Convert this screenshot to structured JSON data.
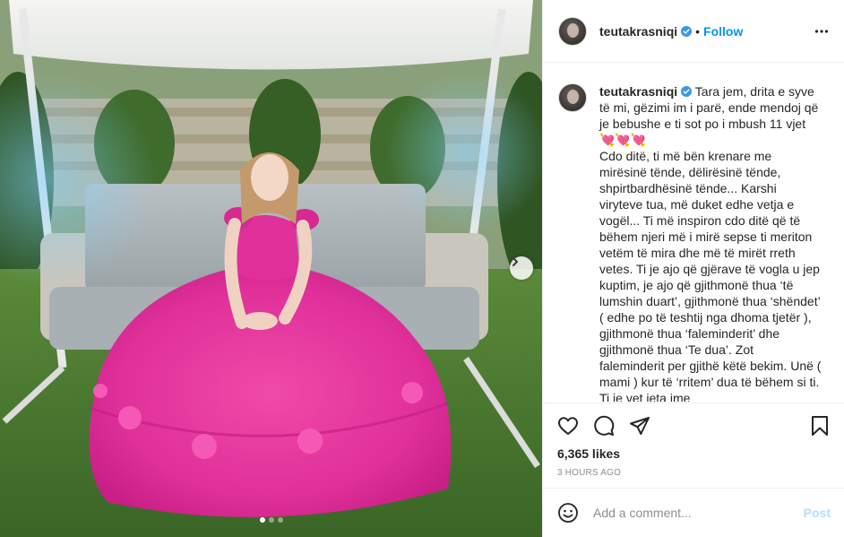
{
  "post": {
    "username": "teutakrasniqi",
    "follow_label": "Follow",
    "separator": "•",
    "caption": "Tara jem, drita e syve të mi, gëzimi im i parë, ende mendoj që je bebushe e ti sot po i mbush 11 vjet 💘💘💘\nCdo ditë, ti më bën krenare me mirësinë tënde, dëlirësinë tënde, shpirtbardhësinë tënde... Karshi viryteve tua, më duket edhe vetja e vogël... Ti më inspiron cdo ditë që të bëhem njeri më i mirë sepse ti meriton vetëm të mira dhe më të mirët rreth vetes. Ti je ajo që gjërave të vogla u jep kuptim, je ajo që gjithmonë thua ‘të lumshin duart’, gjithmonë thua ‘shëndet’ ( edhe po të teshtij nga dhoma tjetër ), gjithmonë thua ‘faleminderit’ dhe gjithmonë thua ‘Te dua’. Zot faleminderit per gjithë këtë bekim. Unë ( mami ) kur të ‘rritem’ dua të bëhem si ti. Ti je vet jeta ime",
    "likes": "6,365 likes",
    "time": "3 HOURS AGO"
  },
  "comment": {
    "placeholder": "Add a comment...",
    "post_label": "Post"
  },
  "carousel": {
    "total": 3,
    "active_index": 0
  },
  "colors": {
    "accent": "#0095f6",
    "post_disabled": "#b2dffc",
    "dress": "#e0309a"
  },
  "icons": {
    "more": "more-options-icon",
    "like": "heart-icon",
    "comment": "comment-icon",
    "share": "share-icon",
    "save": "bookmark-icon",
    "emoji": "emoji-icon",
    "next": "chevron-right-icon",
    "verified": "verified-badge-icon"
  }
}
